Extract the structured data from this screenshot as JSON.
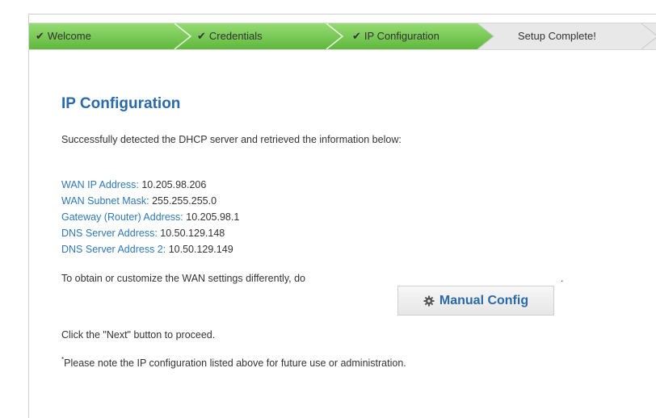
{
  "wizard": {
    "steps": [
      {
        "label": "Welcome",
        "done": true
      },
      {
        "label": "Credentials",
        "done": true
      },
      {
        "label": "IP Configuration",
        "done": true
      },
      {
        "label": "Setup Complete!",
        "done": false
      }
    ],
    "check_glyph": "✔",
    "colors": {
      "done_bg_top": "#8fd66e",
      "done_bg_bottom": "#66bd45",
      "pending_bg": "#e8e8e8",
      "heading": "#2a6aa8",
      "label_blue": "#2f78b8"
    }
  },
  "page": {
    "title": "IP Configuration",
    "intro": "Successfully detected the DHCP server and retrieved the information below:",
    "fields": [
      {
        "label": "WAN IP Address:",
        "value": "10.205.98.206"
      },
      {
        "label": "WAN Subnet Mask:",
        "value": "255.255.255.0"
      },
      {
        "label": "Gateway (Router) Address:",
        "value": "10.205.98.1"
      },
      {
        "label": "DNS Server Address:",
        "value": "10.50.129.148"
      },
      {
        "label": "DNS Server Address 2:",
        "value": "10.50.129.149"
      }
    ],
    "customize_text": "To obtain or customize the WAN settings differently, do",
    "manual_button": {
      "label": "Manual Config",
      "icon": "gear-icon"
    },
    "period": ".",
    "next_text": "Click the \"Next\" button to proceed.",
    "note_mark": "*",
    "note_text": "Please note the IP configuration listed above for future use or administration."
  }
}
